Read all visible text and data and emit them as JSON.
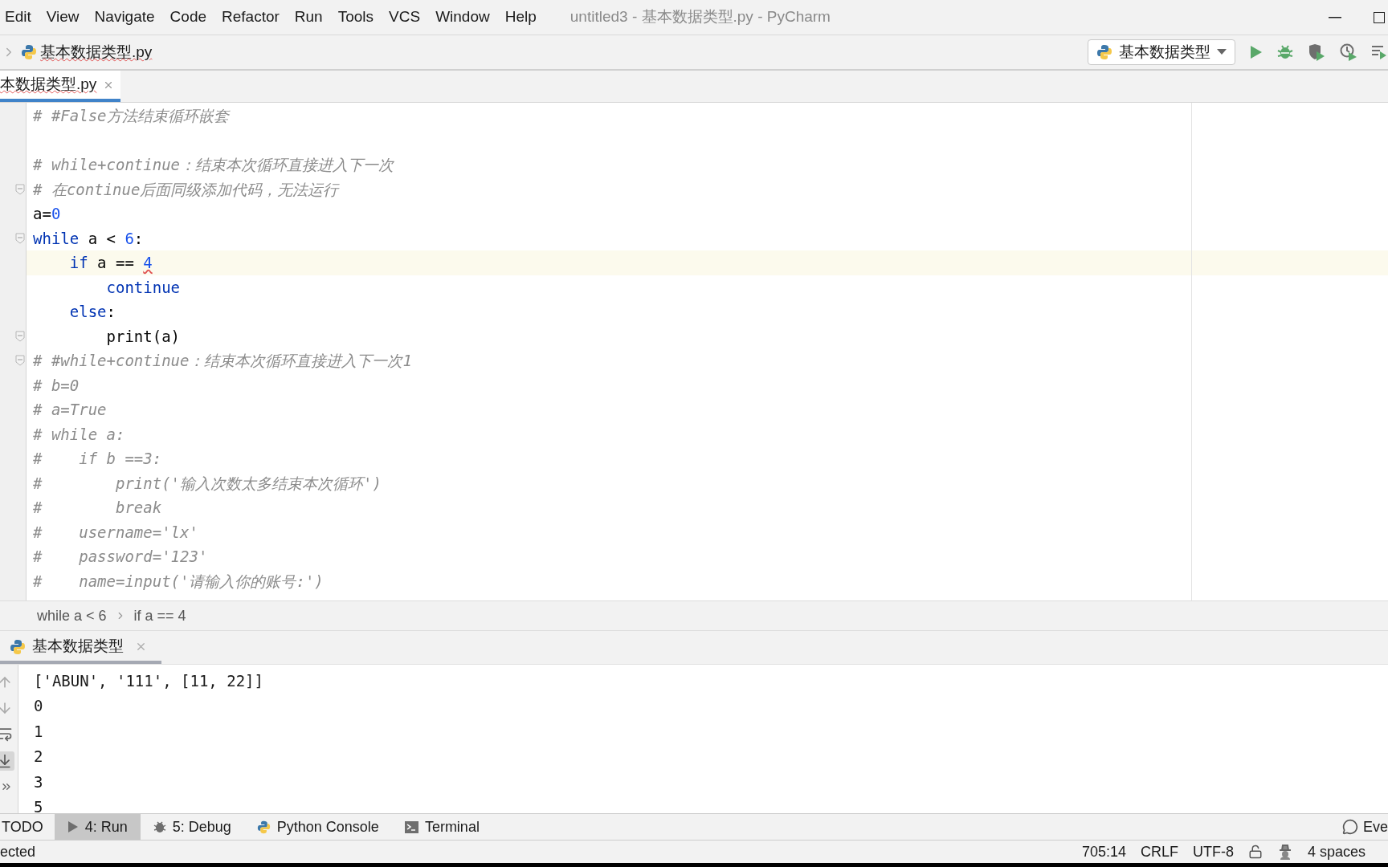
{
  "menu_bar": {
    "items": [
      "Edit",
      "View",
      "Navigate",
      "Code",
      "Refactor",
      "Run",
      "Tools",
      "VCS",
      "Window",
      "Help"
    ],
    "title": "untitled3 - 基本数据类型.py - PyCharm"
  },
  "nav_bar": {
    "file": "基本数据类型.py",
    "run_config": "基本数据类型"
  },
  "editor_tabs": [
    {
      "label": "本数据类型.py",
      "selected": true
    }
  ],
  "editor": {
    "lines": [
      {
        "kind": "comment",
        "text": "# #False方法结束循环嵌套"
      },
      {
        "kind": "blank"
      },
      {
        "kind": "comment",
        "text": "# while+continue：结束本次循环直接进入下一次"
      },
      {
        "kind": "comment",
        "text": "# 在continue后面同级添加代码，无法运行",
        "fold": true
      },
      {
        "kind": "code",
        "tokens": [
          {
            "kind": "plain",
            "text": "a="
          },
          {
            "kind": "number",
            "text": "0"
          }
        ]
      },
      {
        "kind": "code",
        "fold": true,
        "tokens": [
          {
            "kind": "keyword",
            "text": "while"
          },
          {
            "kind": "plain",
            "text": " a < "
          },
          {
            "kind": "number",
            "text": "6"
          },
          {
            "kind": "plain",
            "text": ":"
          }
        ]
      },
      {
        "kind": "code",
        "current": true,
        "tokens": [
          {
            "kind": "keyword",
            "text": "    if"
          },
          {
            "kind": "plain",
            "text": " a == "
          },
          {
            "kind": "number",
            "text": "4",
            "warning": true
          }
        ]
      },
      {
        "kind": "code",
        "tokens": [
          {
            "kind": "keyword",
            "text": "        continue"
          }
        ]
      },
      {
        "kind": "code",
        "tokens": [
          {
            "kind": "keyword",
            "text": "    else"
          },
          {
            "kind": "plain",
            "text": ":"
          }
        ]
      },
      {
        "kind": "code",
        "fold": true,
        "tokens": [
          {
            "kind": "plain",
            "text": "        print(a)"
          }
        ]
      },
      {
        "kind": "comment",
        "text": "# #while+continue：结束本次循环直接进入下一次1",
        "fold": true
      },
      {
        "kind": "comment",
        "text": "# b=0"
      },
      {
        "kind": "comment",
        "text": "# a=True"
      },
      {
        "kind": "comment",
        "text": "# while a:"
      },
      {
        "kind": "comment",
        "text": "#    if b ==3:"
      },
      {
        "kind": "comment",
        "text": "#        print('输入次数太多结束本次循环')"
      },
      {
        "kind": "comment",
        "text": "#        break"
      },
      {
        "kind": "comment",
        "text": "#    username='lx'"
      },
      {
        "kind": "comment",
        "text": "#    password='123'"
      },
      {
        "kind": "comment",
        "text": "#    name=input('请输入你的账号:')"
      }
    ],
    "breadcrumbs": [
      "while a < 6",
      "if a == 4"
    ]
  },
  "run_panel": {
    "tab": "基本数据类型",
    "output": [
      "['ABUN', '111', [11, 22]]",
      "0",
      "1",
      "2",
      "3",
      "5"
    ]
  },
  "tool_windows": [
    {
      "label": "TODO",
      "selected": false,
      "kind": "text"
    },
    {
      "label": "4: Run",
      "selected": true,
      "kind": "run"
    },
    {
      "label": "5: Debug",
      "selected": false,
      "kind": "debug"
    },
    {
      "label": "Python Console",
      "selected": false,
      "kind": "python"
    },
    {
      "label": "Terminal",
      "selected": false,
      "kind": "terminal"
    }
  ],
  "event_log": "Eve",
  "status_bar": {
    "left": "ected",
    "position": "705:14",
    "line_separator": "CRLF",
    "encoding": "UTF-8",
    "indent": "4 spaces"
  }
}
